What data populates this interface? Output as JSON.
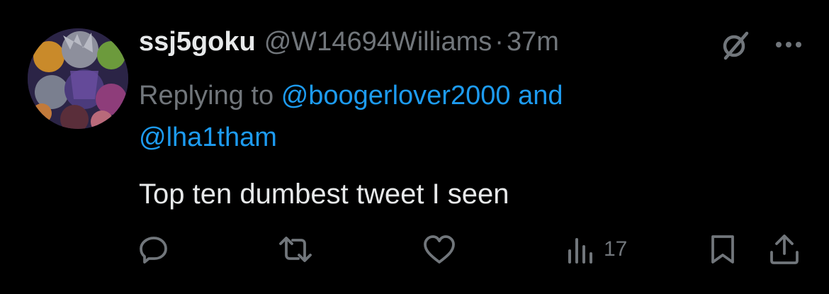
{
  "tweet": {
    "display_name": "ssj5goku",
    "handle": "@W14694Williams",
    "separator": "·",
    "time": "37m",
    "replying_label": "Replying to",
    "mention_1": "@boogerlover2000",
    "conjunction": "and",
    "mention_2": "@lha1tham",
    "text": "Top ten dumbest tweet I seen",
    "views_count": "17"
  },
  "icons": {
    "grok": "grok-slash-icon",
    "more": "more-dots-icon",
    "reply": "reply-icon",
    "retweet": "retweet-icon",
    "like": "heart-icon",
    "views": "views-bar-icon",
    "bookmark": "bookmark-icon",
    "share": "share-icon"
  },
  "colors": {
    "background": "#000000",
    "primary_text": "#e7e9ea",
    "secondary_text": "#71767b",
    "link": "#1d9bf0"
  }
}
